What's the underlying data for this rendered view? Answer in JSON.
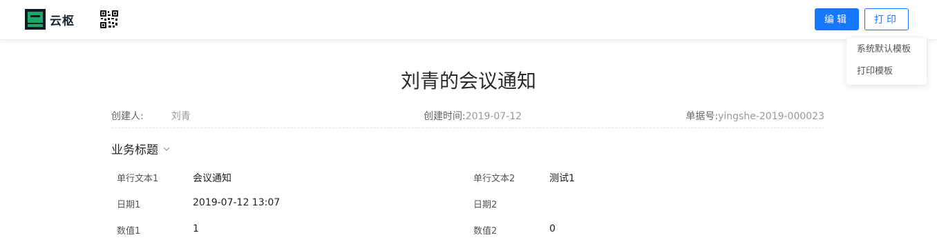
{
  "header": {
    "brand": "云枢",
    "edit_label": "编辑",
    "print_label": "打印",
    "print_menu": [
      "系统默认模板",
      "打印模板"
    ]
  },
  "document": {
    "title": "刘青的会议通知",
    "creator_label": "创建人:",
    "creator": "刘青",
    "created_time_label": "创建时间:",
    "created_time": "2019-07-12",
    "doc_no_label": "单据号:",
    "doc_no": "yingshe-2019-000023"
  },
  "section": {
    "title": "业务标题",
    "fields": [
      {
        "label": "单行文本1",
        "value": "会议通知"
      },
      {
        "label": "单行文本2",
        "value": "测试1"
      },
      {
        "label": "日期1",
        "value": "2019-07-12 13:07"
      },
      {
        "label": "日期2",
        "value": ""
      },
      {
        "label": "数值1",
        "value": "1"
      },
      {
        "label": "数值2",
        "value": "0"
      }
    ]
  },
  "colors": {
    "accent": "#1677ff",
    "logo_green": "#1aa86a",
    "logo_dark": "#0f1c26"
  }
}
